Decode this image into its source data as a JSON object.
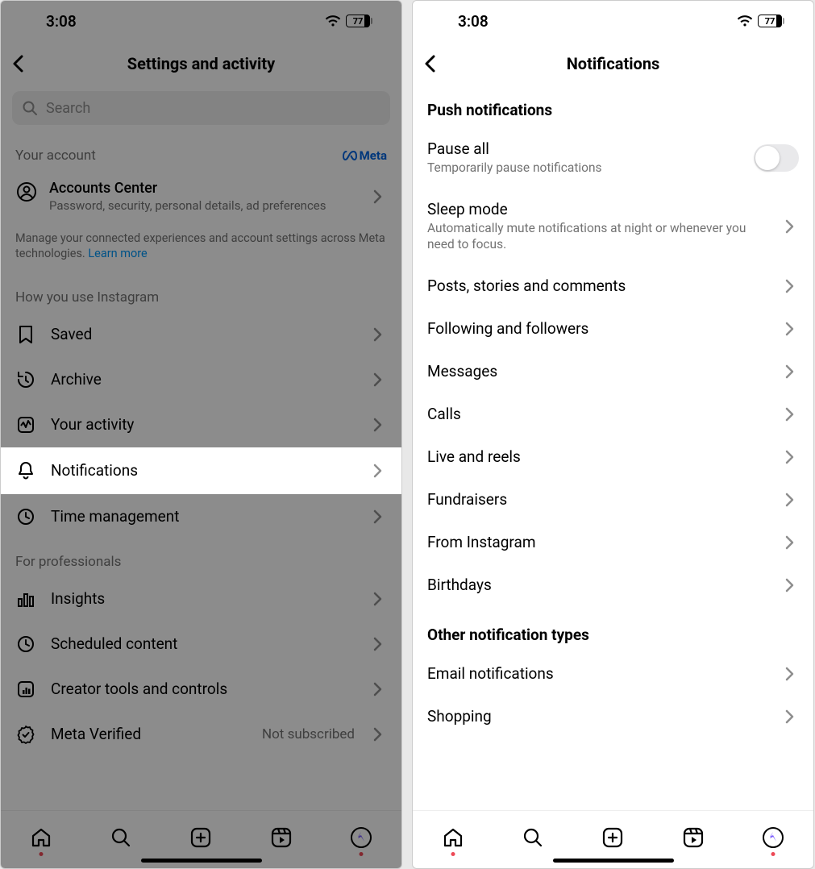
{
  "status": {
    "time": "3:08",
    "battery": "77"
  },
  "left": {
    "title": "Settings and activity",
    "search_placeholder": "Search",
    "your_account_label": "Your account",
    "meta_label": "Meta",
    "accounts_center": {
      "title": "Accounts Center",
      "subtitle": "Password, security, personal details, ad preferences"
    },
    "manage_text": "Manage your connected experiences and account settings across Meta technologies. ",
    "learn_more": "Learn more",
    "how_you_use_label": "How you use Instagram",
    "rows": {
      "saved": "Saved",
      "archive": "Archive",
      "your_activity": "Your activity",
      "notifications": "Notifications",
      "time_management": "Time management"
    },
    "for_professionals_label": "For professionals",
    "pro_rows": {
      "insights": "Insights",
      "scheduled": "Scheduled content",
      "creator_tools": "Creator tools and controls",
      "meta_verified": "Meta Verified",
      "meta_verified_trailing": "Not subscribed"
    }
  },
  "right": {
    "title": "Notifications",
    "push_header": "Push notifications",
    "pause_all": {
      "title": "Pause all",
      "subtitle": "Temporarily pause notifications"
    },
    "sleep_mode": {
      "title": "Sleep mode",
      "subtitle": "Automatically mute notifications at night or whenever you need to focus."
    },
    "rows": {
      "posts": "Posts, stories and comments",
      "following": "Following and followers",
      "messages": "Messages",
      "calls": "Calls",
      "live": "Live and reels",
      "fundraisers": "Fundraisers",
      "from_ig": "From Instagram",
      "birthdays": "Birthdays"
    },
    "other_header": "Other notification types",
    "other_rows": {
      "email": "Email notifications",
      "shopping": "Shopping"
    }
  }
}
